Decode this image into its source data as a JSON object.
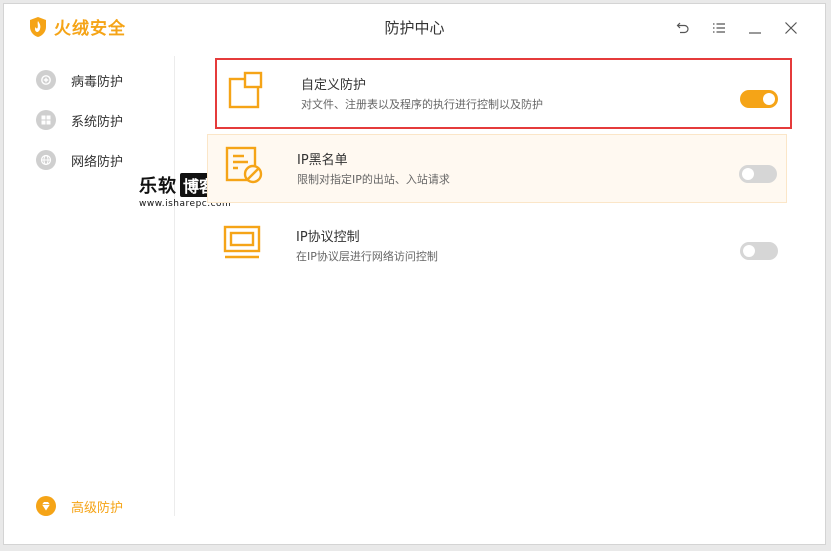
{
  "app": {
    "brand_name": "火绒安全",
    "window_title": "防护中心",
    "brand_color": "#f5a417"
  },
  "window_controls": [
    {
      "name": "back-icon"
    },
    {
      "name": "menu-icon"
    },
    {
      "name": "minimize-icon"
    },
    {
      "name": "close-icon"
    }
  ],
  "sidebar": {
    "items": [
      {
        "label": "病毒防护",
        "icon": "plus-circle-icon",
        "active": false
      },
      {
        "label": "系统防护",
        "icon": "windows-icon",
        "active": false
      },
      {
        "label": "网络防护",
        "icon": "globe-icon",
        "active": false
      },
      {
        "label": "高级防护",
        "icon": "diamond-icon",
        "active": true
      }
    ]
  },
  "features": [
    {
      "title": "自定义防护",
      "desc": "对文件、注册表以及程序的执行进行控制以及防护",
      "enabled": true,
      "icon": "custom-protection-icon"
    },
    {
      "title": "IP黑名单",
      "desc": "限制对指定IP的出站、入站请求",
      "enabled": false,
      "icon": "ip-blacklist-icon"
    },
    {
      "title": "IP协议控制",
      "desc": "在IP协议层进行网络访问控制",
      "enabled": false,
      "icon": "ip-protocol-icon"
    }
  ],
  "watermark": {
    "text": "乐软",
    "boxed": "博客",
    "url": "www.isharepc.com"
  },
  "colors": {
    "accent": "#f5a417",
    "highlight_border": "#e53b3b",
    "toggle_off": "#d6d6d6"
  }
}
